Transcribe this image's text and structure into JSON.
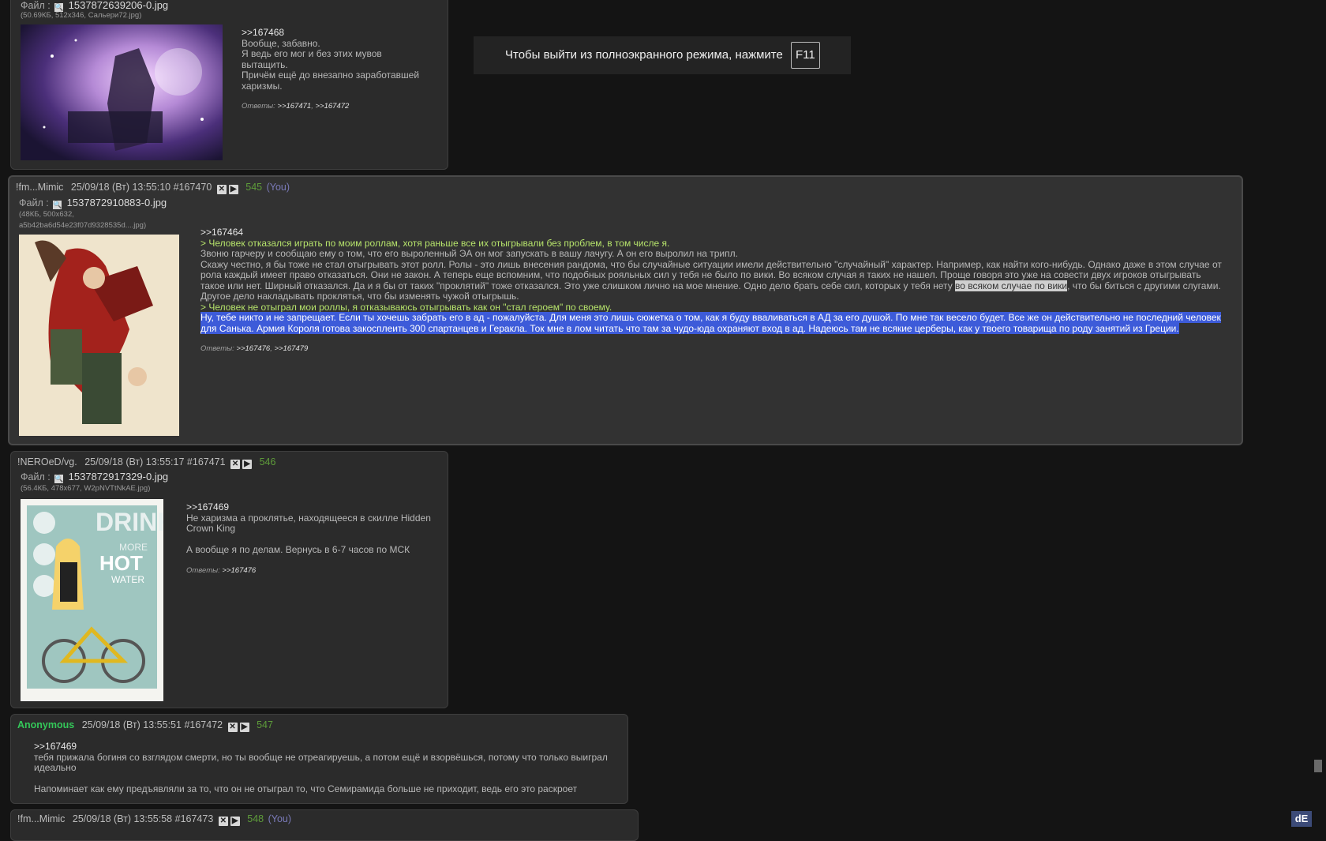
{
  "fullscreen_banner": {
    "text": "Чтобы выйти из полноэкранного режима, нажмите",
    "key": "F11"
  },
  "posts": [
    {
      "file_label": "Файл :",
      "file_name": "1537872639206-0.jpg",
      "file_meta": "(50.69КБ, 512x346, Сальери72.jpg)",
      "ref": ">>167468",
      "lines": [
        "Вообще, забавно.",
        "Я ведь его мог и без этих мувов",
        "вытащить.",
        "Причём ещё до внезапно заработавшей",
        "харизмы."
      ],
      "replies_label": "Ответы:",
      "replies": [
        ">>167471",
        ">>167472"
      ]
    },
    {
      "name": "!fm...Mimic",
      "date": "25/09/18 (Вт) 13:55:10",
      "id": "#167470",
      "num": "545",
      "you": "(You)",
      "file_label": "Файл :",
      "file_name": "1537872910883-0.jpg",
      "file_meta1": "(48КБ, 500x632,",
      "file_meta2": "a5b42ba6d54e23f07d9328535d....jpg)",
      "ref": ">>167464",
      "quote1": "> Человек отказался играть по моим роллам, хотя раньше все их отыгрывали без проблем, в том числе я.",
      "p1": "Звоню гарчеру и сообщаю ему о том, что его выроленный ЭА он мог запускать в вашу лачугу. А он его выролил на трипл.",
      "p2a": "Скажу честно, я бы тоже не стал отыгрывать этот ролл. Ролы - это лишь внесения рандома, что бы случайные ситуации имели действительно \"случайный\" характер. Например, как найти кого-нибудь. Однако даже в этом случае от рола каждый имеет право отказаться. Они не закон. А теперь еще вспомним, что подобных рояльных сил у тебя не было по вики. Во всяком случая я таких не нашел. Проще говоря это уже на совести двух игроков отыгрывать такое или нет. Ширный отказался. Да и я бы от таких \"проклятий\" тоже отказался. Это уже слишком лично на мое мнение. Одно дело брать себе сил, которых у тебя нету ",
      "p2hl": "во всяком случае по вики",
      "p2b": ", что бы биться с другими слугами. Другое дело накладывать проклятья, что бы изменять чужой отыгрышь.",
      "quote2": "> Человек не отыграл мои роллы, я отказываюсь отыгрывать как он \"стал героем\" по своему.",
      "selected": "Ну, тебе никто и не запрещает. Если ты хочешь забрать его в ад - пожалуйста. Для меня это лишь сюжетка о том, как я буду вваливаться в АД за его душой. По мне так весело будет.  Все же он действительно не последний человек для Санька. Армия Короля готова закосплеить 300 спартанцев и Геракла. Ток мне в лом читать что там за чудо-юда охраняют вход в ад. Надеюсь там не всякие церберы, как у твоего товарища по роду занятий из Греции.",
      "replies_label": "Ответы:",
      "replies": [
        ">>167476",
        ">>167479"
      ]
    },
    {
      "name": "!NEROeD/vg.",
      "date": "25/09/18 (Вт) 13:55:17",
      "id": "#167471",
      "num": "546",
      "file_label": "Файл :",
      "file_name": "1537872917329-0.jpg",
      "file_meta": "(56.4КБ, 478x677, W2pNVTtNkAE.jpg)",
      "ref": ">>167469",
      "lines": [
        "Не харизма а проклятье, находящееся в скилле Hidden",
        "Crown King",
        "",
        "А вообще я по делам. Вернусь в 6-7 часов по МСК"
      ],
      "replies_label": "Ответы:",
      "replies": [
        ">>167476"
      ]
    },
    {
      "name": "Anonymous",
      "date": "25/09/18 (Вт) 13:55:51",
      "id": "#167472",
      "num": "547",
      "ref": ">>167469",
      "lines": [
        "тебя прижала богиня со взглядом смерти, но ты вообще не отреагируешь, а потом ещё и взорвёшься, потому что только выиграл",
        "идеально",
        "",
        "Напоминает как ему предъявляли за то, что он не отыграл то, что Семирамида больше не приходит, ведь его это раскроет"
      ]
    },
    {
      "name": "!fm...Mimic",
      "date": "25/09/18 (Вт) 13:55:58",
      "id": "#167473",
      "num": "548",
      "you": "(You)"
    }
  ],
  "corner_logo": "dE"
}
